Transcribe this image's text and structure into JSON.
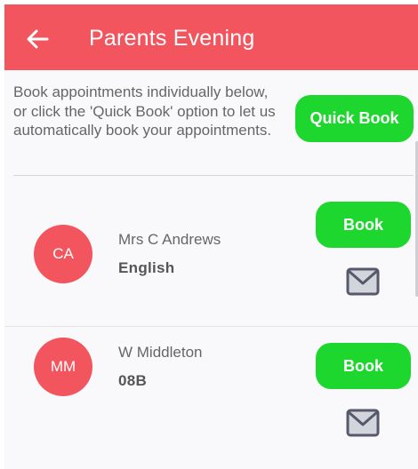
{
  "header": {
    "title": "Parents Evening",
    "back_icon": "arrow-left-icon",
    "background_color": "#f2555d"
  },
  "intro": {
    "text": "Book appointments individually below, or click the 'Quick Book' option to let us automatically book your appointments."
  },
  "quick_book": {
    "label": "Quick Book"
  },
  "accent_green": "#1ed72e",
  "teachers": [
    {
      "initials": "CA",
      "name": "Mrs C Andrews",
      "subject": "English",
      "book_label": "Book",
      "mail_icon": "envelope-icon"
    },
    {
      "initials": "MM",
      "name": "W Middleton",
      "subject": "08B",
      "book_label": "Book",
      "mail_icon": "envelope-icon"
    }
  ]
}
